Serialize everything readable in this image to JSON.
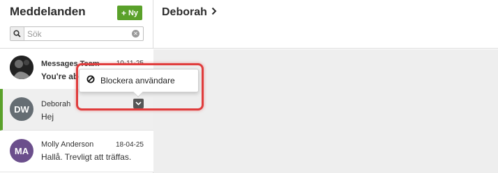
{
  "sidebar": {
    "title": "Meddelanden",
    "new_button": {
      "icon": "plus-icon",
      "label": "Ny"
    },
    "search": {
      "placeholder": "Sök",
      "value": ""
    },
    "conversations": [
      {
        "name": "Messages Team",
        "date": "10-11-25",
        "preview": "You're abou",
        "avatar": "photo"
      },
      {
        "name": "Deborah",
        "date": "",
        "preview": "Hej",
        "initials": "DW",
        "avatar_color": "#656d73",
        "selected": true
      },
      {
        "name": "Molly Anderson",
        "date": "18-04-25",
        "preview": "Hallå. Trevligt att träffas.",
        "initials": "MA",
        "avatar_color": "#6b4f8c"
      }
    ]
  },
  "main": {
    "title": "Deborah"
  },
  "context_menu": {
    "items": [
      {
        "icon": "block-icon",
        "label": "Blockera användare"
      }
    ]
  },
  "colors": {
    "accent": "#5aa12a",
    "highlight": "#e03c3c"
  }
}
